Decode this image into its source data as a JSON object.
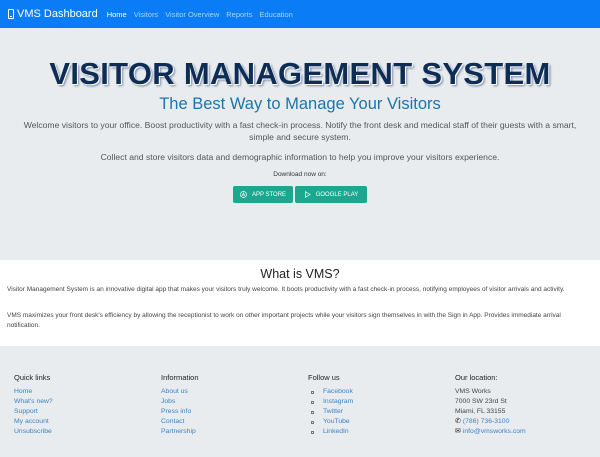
{
  "navbar": {
    "brand": "VMS Dashboard",
    "links": [
      "Home",
      "Visitors",
      "Visitor Overview",
      "Reports",
      "Education"
    ],
    "active": "Home"
  },
  "hero": {
    "title": "VISITOR MANAGEMENT SYSTEM",
    "subtitle": "The Best Way to Manage Your Visitors",
    "description": "Welcome visitors to your office. Boost productivity with a fast check-in process. Notify the front desk and medical staff of their guests with a smart, simple and secure system.",
    "description2": "Collect and store visitors data and demographic information to help you improve your visitors experience.",
    "download_label": "Download now on:",
    "app_store_label": "APP STORE",
    "google_play_label": "GOOGLE PLAY"
  },
  "about": {
    "title": "What is VMS?",
    "paragraph1": "Visitor Management System is an innovative digital app that makes your visitors truly welcome. It boots productivity with a fast check-in process, notifying employees of visitor arrivals and activity.",
    "paragraph2": "VMS maximizes your front desk's efficiency by allowing the receptionist to work on other important projects while your visitors sign themselves in with the Sign in App. Provides immediate arrival notification."
  },
  "footer": {
    "quick_links": {
      "title": "Quick links",
      "items": [
        "Home",
        "What's new?",
        "Support",
        "My account",
        "Unsubscribe"
      ]
    },
    "information": {
      "title": "Information",
      "items": [
        "About us",
        "Jobs",
        "Press info",
        "Contact",
        "Partnership"
      ]
    },
    "follow_us": {
      "title": "Follow us",
      "items": [
        "Facebook",
        "Instagram",
        "Twitter",
        "YouTube",
        "LinkedIn"
      ]
    },
    "location": {
      "title": "Our location:",
      "company": "VMS Works",
      "street": "7000 SW 23rd St",
      "city": "Miami, FL 33155",
      "phone": "(786) 736-3100",
      "email": "info@vmsworks.com"
    }
  },
  "colors": {
    "navbar": "#0a7cf5",
    "button": "#1ea78f",
    "link": "#3b82c4",
    "title": "#0d2d57"
  }
}
